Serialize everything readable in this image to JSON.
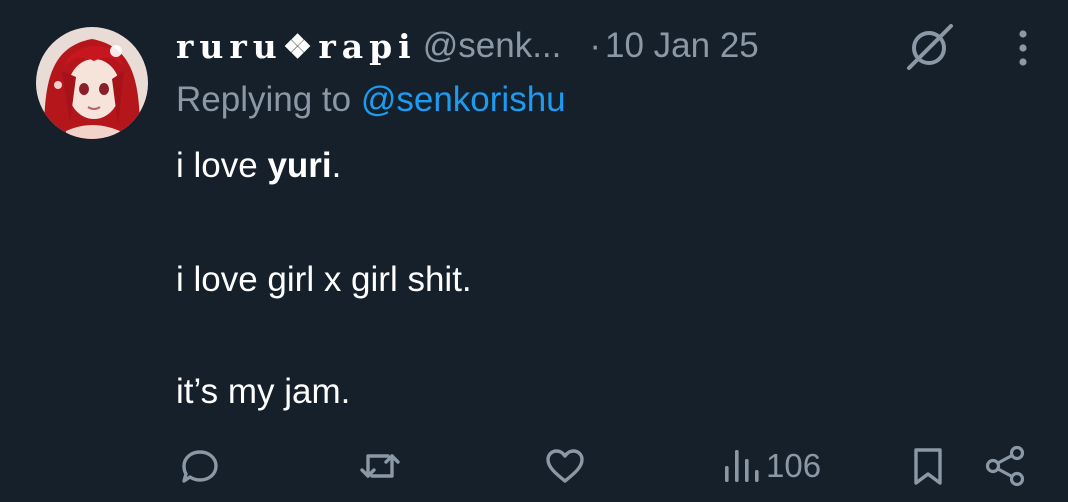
{
  "post": {
    "display_name": "ruru❖rapi",
    "handle": "@senk...",
    "separator": "·",
    "date": "10 Jan 25",
    "reply_prefix": "Replying to",
    "reply_handle": "@senkorishu",
    "lines": [
      {
        "pre": "i love ",
        "bold": "yuri",
        "post": "."
      },
      {
        "text": "i love girl x girl shit."
      },
      {
        "text": "it’s my jam."
      }
    ]
  },
  "actions": {
    "views": "106"
  },
  "icons": {
    "header": [
      "grok-icon",
      "more-icon"
    ],
    "actions": [
      "reply-icon",
      "retweet-icon",
      "like-icon",
      "views-icon",
      "bookmark-icon",
      "share-icon"
    ]
  },
  "colors": {
    "background": "#15202b",
    "text": "#ffffff",
    "muted": "#8b98a5",
    "link": "#1d9bf0"
  }
}
